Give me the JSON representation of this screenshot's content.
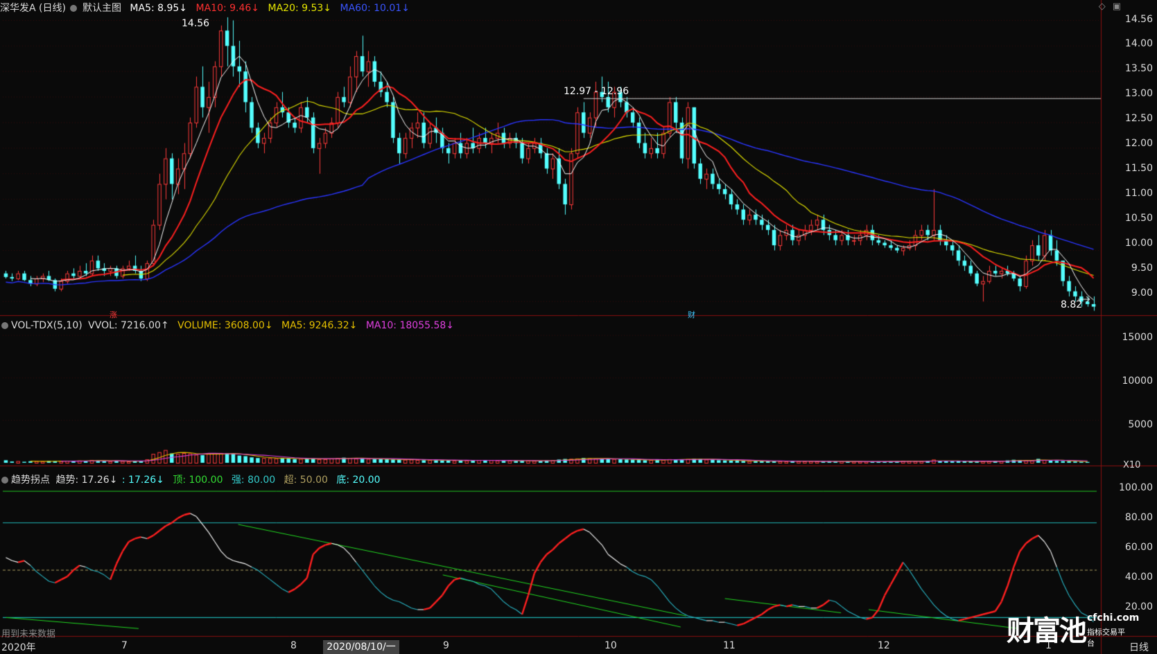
{
  "main_header": {
    "title": "深华发A (日线)",
    "template": "默认主图",
    "ma5": "MA5: 8.95↓",
    "ma10": "MA10: 9.46↓",
    "ma20": "MA20: 9.53↓",
    "ma60": "MA60: 10.01↓"
  },
  "vol_header": {
    "name": "VOL-TDX(5,10)",
    "vvol": "VVOL: 7216.00↑",
    "volume": "VOLUME: 3608.00↓",
    "ma5": "MA5: 9246.32↓",
    "ma10": "MA10: 18055.58↓"
  },
  "ind_header": {
    "name": "趋势拐点",
    "trend": "趋势: 17.26↓",
    "trend2": ": 17.26↓",
    "top": "顶: 100.00",
    "strong": "强: 80.00",
    "over": "超: 50.00",
    "bottom": "底: 20.00"
  },
  "price_axis": [
    "14.56",
    "14.00",
    "13.50",
    "13.00",
    "12.50",
    "12.00",
    "11.50",
    "11.00",
    "10.50",
    "10.00",
    "9.50",
    "9.00"
  ],
  "vol_axis": [
    "15000",
    "10000",
    "5000"
  ],
  "vol_unit": "X10",
  "ind_axis": [
    "100.00",
    "80.00",
    "60.00",
    "40.00",
    "20.00"
  ],
  "annotations": {
    "high": "14.56",
    "low": "8.82",
    "range": "12.97 - 12.96",
    "rise_mark": "涨",
    "fin_mark": "财"
  },
  "x_axis": [
    "2020年",
    "7",
    "8",
    "9",
    "10",
    "11",
    "12",
    "1"
  ],
  "cursor_date": "2020/08/10/一",
  "future_note": "用到未来数据",
  "period": "日线",
  "brand": {
    "name": "财富池",
    "site": "cfchi.com",
    "slogan": "指标交易平台"
  },
  "colors": {
    "up": "#ff3b3b",
    "down": "#54ffff",
    "ma5": "#ffffff",
    "ma10": "#ff2020",
    "ma20": "#e6e600",
    "ma60": "#2a35ff",
    "vma5": "#e6c000",
    "vma10": "#e040e0"
  },
  "chart_data": {
    "type": "candlestick",
    "price_range": [
      8.8,
      14.6
    ],
    "candles": [
      [
        9.55,
        9.6,
        9.45,
        9.48
      ],
      [
        9.48,
        9.55,
        9.4,
        9.45
      ],
      [
        9.45,
        9.6,
        9.42,
        9.55
      ],
      [
        9.55,
        9.6,
        9.4,
        9.42
      ],
      [
        9.42,
        9.5,
        9.3,
        9.35
      ],
      [
        9.35,
        9.5,
        9.3,
        9.45
      ],
      [
        9.45,
        9.55,
        9.38,
        9.5
      ],
      [
        9.5,
        9.6,
        9.4,
        9.42
      ],
      [
        9.42,
        9.45,
        9.2,
        9.25
      ],
      [
        9.25,
        9.45,
        9.2,
        9.4
      ],
      [
        9.4,
        9.6,
        9.35,
        9.55
      ],
      [
        9.55,
        9.65,
        9.45,
        9.5
      ],
      [
        9.5,
        9.7,
        9.45,
        9.6
      ],
      [
        9.6,
        9.75,
        9.5,
        9.55
      ],
      [
        9.55,
        9.9,
        9.5,
        9.8
      ],
      [
        9.8,
        9.9,
        9.6,
        9.65
      ],
      [
        9.65,
        9.75,
        9.5,
        9.6
      ],
      [
        9.6,
        9.7,
        9.5,
        9.65
      ],
      [
        9.65,
        9.7,
        9.45,
        9.5
      ],
      [
        9.5,
        9.7,
        9.45,
        9.65
      ],
      [
        9.65,
        9.8,
        9.6,
        9.7
      ],
      [
        9.7,
        9.9,
        9.55,
        9.6
      ],
      [
        9.6,
        9.7,
        9.4,
        9.45
      ],
      [
        9.45,
        9.8,
        9.4,
        9.75
      ],
      [
        9.75,
        10.6,
        9.7,
        10.5
      ],
      [
        10.5,
        11.5,
        10.4,
        11.3
      ],
      [
        11.3,
        12.0,
        11.0,
        11.8
      ],
      [
        11.8,
        11.9,
        11.0,
        11.3
      ],
      [
        11.3,
        11.8,
        11.1,
        11.6
      ],
      [
        11.6,
        12.1,
        11.2,
        11.9
      ],
      [
        11.9,
        12.6,
        11.8,
        12.5
      ],
      [
        12.5,
        13.4,
        12.4,
        13.2
      ],
      [
        13.2,
        13.6,
        12.6,
        12.8
      ],
      [
        12.8,
        13.3,
        12.3,
        13.0
      ],
      [
        13.0,
        13.7,
        12.8,
        13.6
      ],
      [
        13.6,
        14.4,
        13.4,
        14.3
      ],
      [
        14.3,
        14.56,
        13.6,
        14.0
      ],
      [
        14.0,
        14.5,
        13.4,
        13.6
      ],
      [
        13.6,
        14.1,
        13.2,
        13.5
      ],
      [
        13.5,
        13.7,
        12.7,
        12.9
      ],
      [
        12.9,
        13.0,
        12.3,
        12.4
      ],
      [
        12.4,
        12.5,
        12.0,
        12.1
      ],
      [
        12.1,
        12.3,
        11.9,
        12.2
      ],
      [
        12.2,
        12.6,
        12.1,
        12.5
      ],
      [
        12.5,
        12.9,
        12.4,
        12.8
      ],
      [
        12.8,
        13.1,
        12.6,
        12.7
      ],
      [
        12.7,
        12.8,
        12.4,
        12.5
      ],
      [
        12.5,
        12.6,
        12.3,
        12.4
      ],
      [
        12.4,
        12.9,
        12.3,
        12.8
      ],
      [
        12.8,
        13.0,
        12.5,
        12.6
      ],
      [
        12.6,
        12.7,
        11.9,
        12.0
      ],
      [
        12.0,
        12.2,
        11.5,
        12.1
      ],
      [
        12.1,
        12.4,
        12.0,
        12.3
      ],
      [
        12.3,
        12.6,
        12.2,
        12.5
      ],
      [
        12.5,
        13.1,
        12.4,
        13.0
      ],
      [
        13.0,
        13.2,
        12.8,
        12.9
      ],
      [
        12.9,
        13.6,
        12.8,
        13.4
      ],
      [
        13.4,
        13.9,
        13.1,
        13.8
      ],
      [
        13.8,
        14.2,
        13.4,
        13.5
      ],
      [
        13.5,
        13.9,
        13.2,
        13.7
      ],
      [
        13.7,
        13.8,
        13.2,
        13.3
      ],
      [
        13.3,
        13.5,
        13.0,
        13.1
      ],
      [
        13.1,
        13.3,
        12.8,
        12.9
      ],
      [
        12.9,
        13.0,
        12.1,
        12.2
      ],
      [
        12.2,
        12.3,
        11.7,
        11.9
      ],
      [
        11.9,
        12.3,
        11.8,
        12.2
      ],
      [
        12.2,
        12.5,
        12.0,
        12.4
      ],
      [
        12.4,
        12.7,
        12.2,
        12.5
      ],
      [
        12.5,
        12.7,
        12.0,
        12.1
      ],
      [
        12.1,
        12.5,
        12.0,
        12.4
      ],
      [
        12.4,
        12.6,
        12.1,
        12.3
      ],
      [
        12.3,
        12.4,
        11.9,
        12.0
      ],
      [
        12.0,
        12.1,
        11.7,
        11.9
      ],
      [
        11.9,
        12.2,
        11.8,
        12.1
      ],
      [
        12.1,
        12.3,
        11.8,
        11.9
      ],
      [
        11.9,
        12.2,
        11.8,
        12.1
      ],
      [
        12.1,
        12.4,
        11.9,
        12.0
      ],
      [
        12.0,
        12.3,
        11.9,
        12.2
      ],
      [
        12.2,
        12.4,
        12.0,
        12.1
      ],
      [
        12.1,
        12.3,
        11.9,
        12.2
      ],
      [
        12.2,
        12.5,
        12.1,
        12.3
      ],
      [
        12.3,
        12.4,
        12.0,
        12.1
      ],
      [
        12.1,
        12.3,
        12.0,
        12.2
      ],
      [
        12.2,
        12.3,
        12.0,
        12.1
      ],
      [
        12.1,
        12.2,
        11.7,
        11.8
      ],
      [
        11.8,
        12.1,
        11.7,
        12.0
      ],
      [
        12.0,
        12.2,
        11.9,
        12.1
      ],
      [
        12.1,
        12.2,
        11.8,
        11.9
      ],
      [
        11.9,
        12.0,
        11.5,
        11.6
      ],
      [
        11.6,
        11.9,
        11.4,
        11.8
      ],
      [
        11.8,
        12.0,
        11.2,
        11.3
      ],
      [
        11.3,
        11.4,
        10.7,
        10.9
      ],
      [
        10.9,
        12.0,
        10.8,
        11.9
      ],
      [
        11.9,
        12.8,
        11.8,
        12.7
      ],
      [
        12.7,
        12.9,
        12.2,
        12.3
      ],
      [
        12.3,
        12.7,
        12.2,
        12.6
      ],
      [
        12.6,
        13.3,
        12.4,
        13.1
      ],
      [
        13.1,
        13.4,
        12.9,
        13.0
      ],
      [
        13.0,
        13.3,
        12.7,
        12.8
      ],
      [
        12.8,
        13.2,
        12.6,
        13.1
      ],
      [
        13.1,
        13.2,
        12.8,
        12.9
      ],
      [
        12.9,
        13.0,
        12.6,
        12.7
      ],
      [
        12.7,
        12.8,
        12.4,
        12.5
      ],
      [
        12.5,
        12.6,
        12.0,
        12.1
      ],
      [
        12.1,
        12.3,
        11.8,
        11.9
      ],
      [
        11.9,
        12.2,
        11.8,
        12.0
      ],
      [
        12.0,
        12.3,
        11.8,
        11.9
      ],
      [
        11.9,
        12.4,
        11.8,
        12.3
      ],
      [
        12.3,
        13.0,
        12.2,
        12.9
      ],
      [
        12.9,
        13.0,
        12.3,
        12.5
      ],
      [
        12.5,
        12.6,
        11.7,
        11.8
      ],
      [
        11.8,
        12.9,
        11.6,
        12.8
      ],
      [
        12.8,
        12.8,
        11.6,
        11.7
      ],
      [
        11.7,
        11.8,
        11.3,
        11.4
      ],
      [
        11.4,
        11.6,
        11.2,
        11.5
      ],
      [
        11.5,
        11.6,
        11.2,
        11.3
      ],
      [
        11.3,
        11.4,
        11.1,
        11.2
      ],
      [
        11.2,
        11.3,
        11.0,
        11.1
      ],
      [
        11.1,
        11.2,
        10.8,
        10.9
      ],
      [
        10.9,
        11.0,
        10.7,
        10.8
      ],
      [
        10.8,
        10.9,
        10.5,
        10.6
      ],
      [
        10.6,
        10.8,
        10.5,
        10.7
      ],
      [
        10.7,
        10.8,
        10.5,
        10.6
      ],
      [
        10.6,
        10.7,
        10.4,
        10.5
      ],
      [
        10.5,
        10.6,
        10.3,
        10.4
      ],
      [
        10.4,
        10.5,
        10.0,
        10.1
      ],
      [
        10.1,
        10.4,
        10.0,
        10.3
      ],
      [
        10.3,
        10.5,
        10.2,
        10.4
      ],
      [
        10.4,
        10.5,
        10.1,
        10.2
      ],
      [
        10.2,
        10.4,
        10.1,
        10.3
      ],
      [
        10.3,
        10.5,
        10.2,
        10.4
      ],
      [
        10.4,
        10.6,
        10.3,
        10.5
      ],
      [
        10.5,
        10.7,
        10.4,
        10.6
      ],
      [
        10.6,
        10.7,
        10.3,
        10.4
      ],
      [
        10.4,
        10.5,
        10.2,
        10.3
      ],
      [
        10.3,
        10.4,
        10.1,
        10.2
      ],
      [
        10.2,
        10.4,
        10.1,
        10.3
      ],
      [
        10.3,
        10.4,
        10.1,
        10.2
      ],
      [
        10.2,
        10.3,
        10.1,
        10.2
      ],
      [
        10.2,
        10.4,
        10.1,
        10.3
      ],
      [
        10.3,
        10.5,
        10.2,
        10.4
      ],
      [
        10.4,
        10.5,
        10.1,
        10.2
      ],
      [
        10.2,
        10.3,
        10.1,
        10.15
      ],
      [
        10.15,
        10.2,
        10.05,
        10.1
      ],
      [
        10.1,
        10.2,
        10.0,
        10.05
      ],
      [
        10.05,
        10.1,
        9.95,
        10.0
      ],
      [
        10.0,
        10.1,
        9.9,
        10.05
      ],
      [
        10.05,
        10.2,
        10.0,
        10.1
      ],
      [
        10.1,
        10.4,
        10.0,
        10.3
      ],
      [
        10.3,
        10.5,
        10.2,
        10.4
      ],
      [
        10.4,
        10.5,
        10.2,
        10.3
      ],
      [
        10.3,
        11.2,
        10.2,
        10.4
      ],
      [
        10.4,
        10.5,
        10.1,
        10.2
      ],
      [
        10.2,
        10.3,
        10.0,
        10.1
      ],
      [
        10.1,
        10.2,
        9.9,
        10.0
      ],
      [
        10.0,
        10.1,
        9.7,
        9.8
      ],
      [
        9.8,
        9.9,
        9.6,
        9.7
      ],
      [
        9.7,
        9.8,
        9.5,
        9.55
      ],
      [
        9.55,
        9.6,
        9.3,
        9.35
      ],
      [
        9.35,
        9.5,
        9.0,
        9.4
      ],
      [
        9.4,
        9.7,
        9.35,
        9.6
      ],
      [
        9.6,
        9.7,
        9.5,
        9.55
      ],
      [
        9.55,
        9.65,
        9.45,
        9.6
      ],
      [
        9.6,
        9.7,
        9.5,
        9.55
      ],
      [
        9.55,
        9.6,
        9.4,
        9.45
      ],
      [
        9.45,
        9.5,
        9.2,
        9.3
      ],
      [
        9.3,
        9.9,
        9.25,
        9.8
      ],
      [
        9.8,
        10.2,
        9.7,
        10.1
      ],
      [
        10.1,
        10.3,
        9.8,
        9.9
      ],
      [
        9.9,
        10.4,
        9.8,
        10.3
      ],
      [
        10.3,
        10.4,
        9.9,
        10.0
      ],
      [
        10.0,
        10.2,
        9.7,
        9.8
      ],
      [
        9.8,
        9.8,
        9.3,
        9.4
      ],
      [
        9.4,
        9.5,
        9.1,
        9.2
      ],
      [
        9.2,
        9.3,
        9.0,
        9.1
      ],
      [
        9.1,
        9.2,
        8.9,
        9.0
      ],
      [
        9.0,
        9.1,
        8.9,
        8.95
      ],
      [
        8.95,
        9.1,
        8.82,
        8.9
      ]
    ],
    "volume": [
      300,
      150,
      200,
      120,
      180,
      200,
      160,
      220,
      180,
      200,
      240,
      200,
      260,
      220,
      320,
      260,
      200,
      180,
      240,
      200,
      160,
      180,
      200,
      400,
      1050,
      1250,
      1500,
      1100,
      1050,
      1150,
      1100,
      950,
      900,
      1050,
      1100,
      1150,
      1100,
      1050,
      850,
      780,
      640,
      560,
      560,
      540,
      520,
      540,
      480,
      440,
      460,
      480,
      500,
      420,
      420,
      500,
      560,
      600,
      560,
      500,
      480,
      450,
      440,
      420,
      400,
      380,
      360,
      360,
      380,
      340,
      300,
      310,
      300,
      280,
      260,
      260,
      280,
      260,
      300,
      300,
      280,
      300,
      260,
      240,
      240,
      220,
      260,
      240,
      220,
      240,
      260,
      300,
      380,
      450,
      470,
      500,
      560,
      520,
      480,
      470,
      460,
      440,
      400,
      380,
      360,
      320,
      300,
      320,
      320,
      360,
      420,
      400,
      380,
      440,
      480,
      450,
      380,
      340,
      300,
      280,
      250,
      240,
      220,
      200,
      200,
      180,
      170,
      190,
      180,
      170,
      190,
      180,
      170,
      180,
      160,
      150,
      150,
      160,
      170,
      150,
      140,
      140,
      140,
      150,
      140,
      160,
      160,
      170,
      220,
      200,
      180,
      170,
      220,
      380,
      200,
      180,
      160,
      170,
      180,
      160,
      150,
      170,
      180,
      200,
      220,
      280,
      350,
      300,
      260,
      250,
      460,
      320,
      260,
      220,
      200,
      180,
      140,
      120,
      100
    ],
    "trend": [
      58,
      56,
      55,
      56,
      53,
      49,
      46,
      43,
      42,
      44,
      46,
      50,
      53,
      52,
      50,
      49,
      47,
      44,
      54,
      62,
      68,
      70,
      71,
      70,
      72,
      75,
      78,
      80,
      83,
      85,
      86,
      84,
      79,
      74,
      68,
      62,
      58,
      56,
      55,
      54,
      52,
      50,
      47,
      44,
      41,
      38,
      36,
      38,
      41,
      45,
      60,
      64,
      66,
      67,
      66,
      64,
      60,
      55,
      50,
      45,
      40,
      36,
      33,
      31,
      30,
      28,
      26,
      25,
      25,
      26,
      30,
      34,
      40,
      44,
      45,
      44,
      43,
      41,
      40,
      38,
      34,
      30,
      27,
      25,
      22,
      34,
      48,
      55,
      60,
      63,
      67,
      70,
      73,
      75,
      76,
      74,
      70,
      66,
      60,
      57,
      54,
      52,
      49,
      47,
      46,
      44,
      40,
      35,
      30,
      26,
      23,
      21,
      20,
      19,
      18,
      18,
      17,
      17,
      16,
      15,
      16,
      18,
      20,
      22,
      25,
      27,
      28,
      27,
      28,
      27,
      27,
      26,
      26,
      28,
      31,
      30,
      27,
      24,
      22,
      20,
      19,
      20,
      25,
      34,
      41,
      48,
      55,
      50,
      44,
      38,
      33,
      28,
      24,
      21,
      19,
      18,
      19,
      20,
      21,
      22,
      23,
      24,
      30,
      40,
      52,
      62,
      67,
      70,
      72,
      68,
      62,
      52,
      42,
      34,
      28,
      23,
      21,
      17.26
    ]
  }
}
